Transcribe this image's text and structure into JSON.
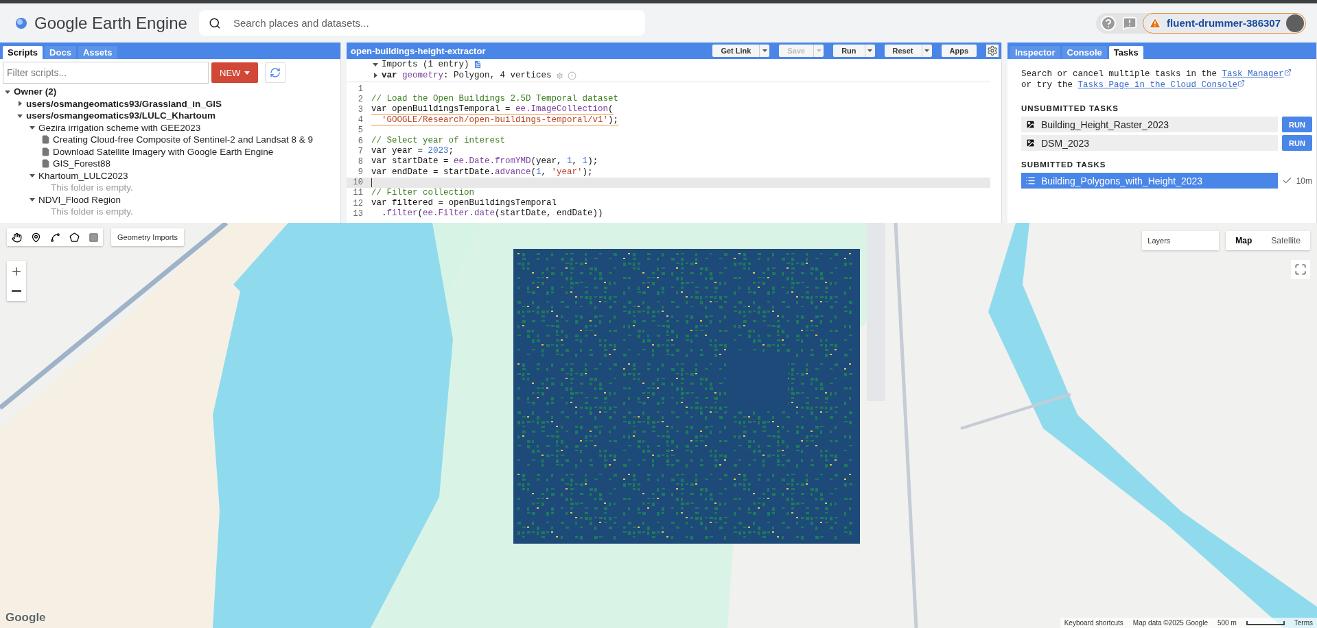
{
  "app": {
    "title": "Google Earth Engine",
    "search": {
      "placeholder": "Search places and datasets..."
    },
    "account": {
      "project": "fluent-drummer-386307",
      "warning": true
    }
  },
  "left_panel": {
    "tabs": [
      {
        "label": "Scripts",
        "selected": true
      },
      {
        "label": "Docs",
        "selected": false
      },
      {
        "label": "Assets",
        "selected": false
      }
    ],
    "filter": {
      "placeholder": "Filter scripts..."
    },
    "new_button": "NEW",
    "tree": [
      {
        "kind": "group",
        "label": "Owner (2)",
        "expanded": true,
        "children": [
          {
            "kind": "repo",
            "label": "users/osmangeomatics93/Grassland_in_GIS",
            "expanded": false
          },
          {
            "kind": "repo",
            "label": "users/osmangeomatics93/LULC_Khartoum",
            "expanded": true,
            "children": [
              {
                "kind": "folder",
                "label": "Gezira irrigation scheme with GEE2023",
                "expanded": true,
                "children": [
                  {
                    "kind": "file",
                    "label": "Creating Cloud-free Composite of Sentinel-2 and Landsat 8 & 9"
                  },
                  {
                    "kind": "file",
                    "label": "Download Satellite Imagery with Google Earth Engine"
                  },
                  {
                    "kind": "file",
                    "label": "GIS_Forest88"
                  }
                ]
              },
              {
                "kind": "folder",
                "label": "Khartoum_LULC2023",
                "expanded": true,
                "children": [
                  {
                    "kind": "note",
                    "label": "This folder is empty."
                  }
                ]
              },
              {
                "kind": "folder",
                "label": "NDVI_Flood Region",
                "expanded": true,
                "children": [
                  {
                    "kind": "note",
                    "label": "This folder is empty."
                  }
                ]
              }
            ]
          }
        ]
      }
    ]
  },
  "editor": {
    "title": "open-buildings-height-extractor",
    "buttons": [
      {
        "label": "Get Link",
        "disabled": false
      },
      {
        "label": "Save",
        "disabled": true
      },
      {
        "label": "Run",
        "disabled": false
      },
      {
        "label": "Reset",
        "disabled": false
      },
      {
        "label": "Apps",
        "disabled": false,
        "kind": "plain"
      }
    ],
    "imports": {
      "label": "Imports (1 entry)",
      "expanded": true,
      "entries": [
        {
          "keyword": "var",
          "name": "geometry",
          "detail": ": Polygon, 4 vertices"
        }
      ]
    },
    "lines": [
      {
        "number": "1",
        "current": false
      },
      {
        "number": "2",
        "current": false,
        "tokens": [
          {
            "kind": "comment",
            "text": "// Load the Open Buildings 2.5D Temporal dataset"
          }
        ]
      },
      {
        "number": "3",
        "current": false,
        "warning": true,
        "tokens": [
          {
            "kind": "plain",
            "text": "var openBuildingsTemporal = "
          },
          {
            "kind": "fn",
            "text": "ee.ImageCollection"
          },
          {
            "kind": "plain",
            "text": "("
          }
        ]
      },
      {
        "number": "4",
        "current": false,
        "warning": true,
        "tokens": [
          {
            "kind": "string",
            "text": "  'GOOGLE/Research/open-buildings-temporal/v1'"
          },
          {
            "kind": "plain",
            "text": ");"
          }
        ]
      },
      {
        "number": "5",
        "current": false
      },
      {
        "number": "6",
        "current": false,
        "tokens": [
          {
            "kind": "comment",
            "text": "// Select year of interest"
          }
        ]
      },
      {
        "number": "7",
        "current": false,
        "tokens": [
          {
            "kind": "plain",
            "text": "var year = "
          },
          {
            "kind": "number",
            "text": "2023"
          },
          {
            "kind": "plain",
            "text": ";"
          }
        ]
      },
      {
        "number": "8",
        "current": false,
        "tokens": [
          {
            "kind": "plain",
            "text": "var startDate = "
          },
          {
            "kind": "fn",
            "text": "ee.Date.fromYMD"
          },
          {
            "kind": "plain",
            "text": "(year, "
          },
          {
            "kind": "number",
            "text": "1"
          },
          {
            "kind": "plain",
            "text": ", "
          },
          {
            "kind": "number",
            "text": "1"
          },
          {
            "kind": "plain",
            "text": ");"
          }
        ]
      },
      {
        "number": "9",
        "current": false,
        "tokens": [
          {
            "kind": "plain",
            "text": "var endDate = startDate."
          },
          {
            "kind": "fn",
            "text": "advance"
          },
          {
            "kind": "plain",
            "text": "("
          },
          {
            "kind": "number",
            "text": "1"
          },
          {
            "kind": "plain",
            "text": ", "
          },
          {
            "kind": "string",
            "text": "'year'"
          },
          {
            "kind": "plain",
            "text": ");"
          }
        ]
      },
      {
        "number": "10",
        "current": true
      },
      {
        "number": "11",
        "current": false,
        "tokens": [
          {
            "kind": "comment",
            "text": "// Filter collection"
          }
        ]
      },
      {
        "number": "12",
        "current": false,
        "tokens": [
          {
            "kind": "plain",
            "text": "var filtered = openBuildingsTemporal"
          }
        ]
      },
      {
        "number": "13",
        "current": false,
        "tokens": [
          {
            "kind": "plain",
            "text": "  ."
          },
          {
            "kind": "fn",
            "text": "filter"
          },
          {
            "kind": "plain",
            "text": "("
          },
          {
            "kind": "fn",
            "text": "ee.Filter.date"
          },
          {
            "kind": "plain",
            "text": "(startDate, endDate))"
          }
        ]
      }
    ]
  },
  "right_panel": {
    "tabs": [
      {
        "label": "Inspector",
        "selected": false
      },
      {
        "label": "Console",
        "selected": false
      },
      {
        "label": "Tasks",
        "selected": true
      }
    ],
    "help": [
      {
        "kind": "text",
        "text": "Search or cancel multiple tasks in the "
      },
      {
        "kind": "link",
        "text": "Task Manager"
      },
      {
        "kind": "text",
        "text": " or try the "
      },
      {
        "kind": "link",
        "text": "Tasks Page in the Cloud Console"
      }
    ],
    "unsubmitted_heading": "UNSUBMITTED TASKS",
    "unsubmitted": [
      {
        "kind": "image",
        "name": "Building_Height_Raster_2023",
        "action": "RUN"
      },
      {
        "kind": "image",
        "name": "DSM_2023",
        "action": "RUN"
      }
    ],
    "submitted_heading": "SUBMITTED TASKS",
    "submitted": [
      {
        "kind": "table",
        "name": "Building_Polygons_with_Height_2023",
        "done": true,
        "time": "10m"
      }
    ]
  },
  "map": {
    "geometry_button": "Geometry Imports",
    "layers_button": "Layers",
    "map_types": [
      {
        "label": "Map",
        "selected": true
      },
      {
        "label": "Satellite",
        "selected": false
      }
    ],
    "logo": "Google",
    "footer": [
      "Keyboard shortcuts",
      "Map data ©2025 Google"
    ],
    "scale": "500 m",
    "terms": "Terms"
  }
}
